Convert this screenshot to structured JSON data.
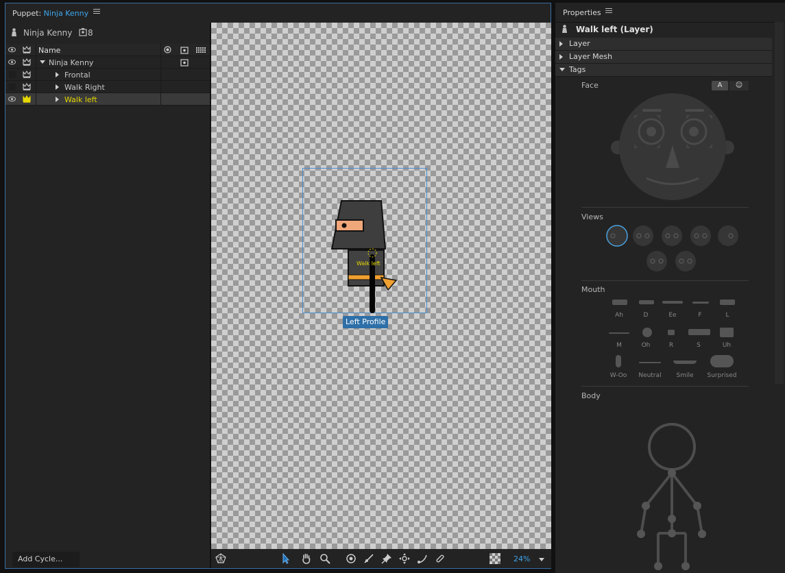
{
  "puppet_panel": {
    "title_prefix": "Puppet:",
    "title_name": "Ninja Kenny",
    "puppet_name": "Ninja Kenny",
    "puppet_count": "8",
    "column_name": "Name",
    "layers": [
      {
        "name": "Ninja Kenny",
        "expanded": true,
        "visible": true
      },
      {
        "name": "Frontal",
        "expanded": false,
        "visible": false
      },
      {
        "name": "Walk Right",
        "expanded": false,
        "visible": false
      },
      {
        "name": "Walk left",
        "expanded": false,
        "visible": true,
        "selected": true
      }
    ],
    "add_cycle": "Add Cycle..."
  },
  "canvas": {
    "layer_overlay_label": "Walk left",
    "profile_tag": "Left Profile",
    "zoom": "24%"
  },
  "properties_panel": {
    "title": "Properties",
    "selection": "Walk left  (Layer)",
    "sections": [
      "Layer",
      "Layer Mesh",
      "Tags"
    ],
    "face_label": "Face",
    "face_button_a": "A",
    "face_button_smile": "☺",
    "views_label": "Views",
    "mouth_label": "Mouth",
    "mouth_shapes": [
      "Ah",
      "D",
      "Ee",
      "F",
      "L",
      "M",
      "Oh",
      "R",
      "S",
      "Uh",
      "W-Oo",
      "Neutral",
      "Smile",
      "Surprised"
    ],
    "body_label": "Body"
  },
  "colors": {
    "accent_blue": "#3ea6ee",
    "selected_yellow": "#e6d800",
    "panel_bg": "#232323"
  }
}
